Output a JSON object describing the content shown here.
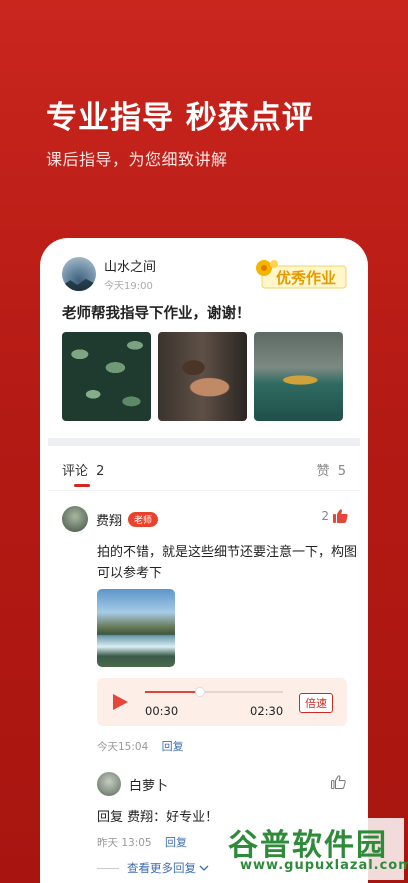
{
  "hero": {
    "title": "专业指导 秒获点评",
    "subtitle": "课后指导，为您细致讲解"
  },
  "post": {
    "user": "山水之间",
    "time": "今天19:00",
    "badge": "优秀作业",
    "text": "老师帮我指导下作业，谢谢！",
    "photos": [
      "leaves-photo",
      "soil-hands-photo",
      "lake-island-photo"
    ]
  },
  "tabs": {
    "comments_label": "评论",
    "comments_count": "2",
    "likes_label": "赞",
    "likes_count": "5"
  },
  "comment": {
    "user": "费翔",
    "role_badge": "老师",
    "likes": "2",
    "text": "拍的不错，就是这些细节还要注意一下，构图可以参考下",
    "audio": {
      "current": "00:30",
      "total": "02:30",
      "progress": 0.4,
      "speed_label": "倍速"
    },
    "time": "今天15:04",
    "reply_label": "回复"
  },
  "reply": {
    "user": "白萝卜",
    "text": "回复 费翔：好专业！",
    "time": "昨天 13:05",
    "reply_label": "回复",
    "more_label": "查看更多回复"
  },
  "watermark": {
    "cn": "谷普软件园",
    "url": "www.gupuxlazal.com"
  },
  "colors": {
    "brand_red": "#c9261e",
    "teacher_badge": "#e9432d",
    "link_blue": "#3e6db5"
  }
}
